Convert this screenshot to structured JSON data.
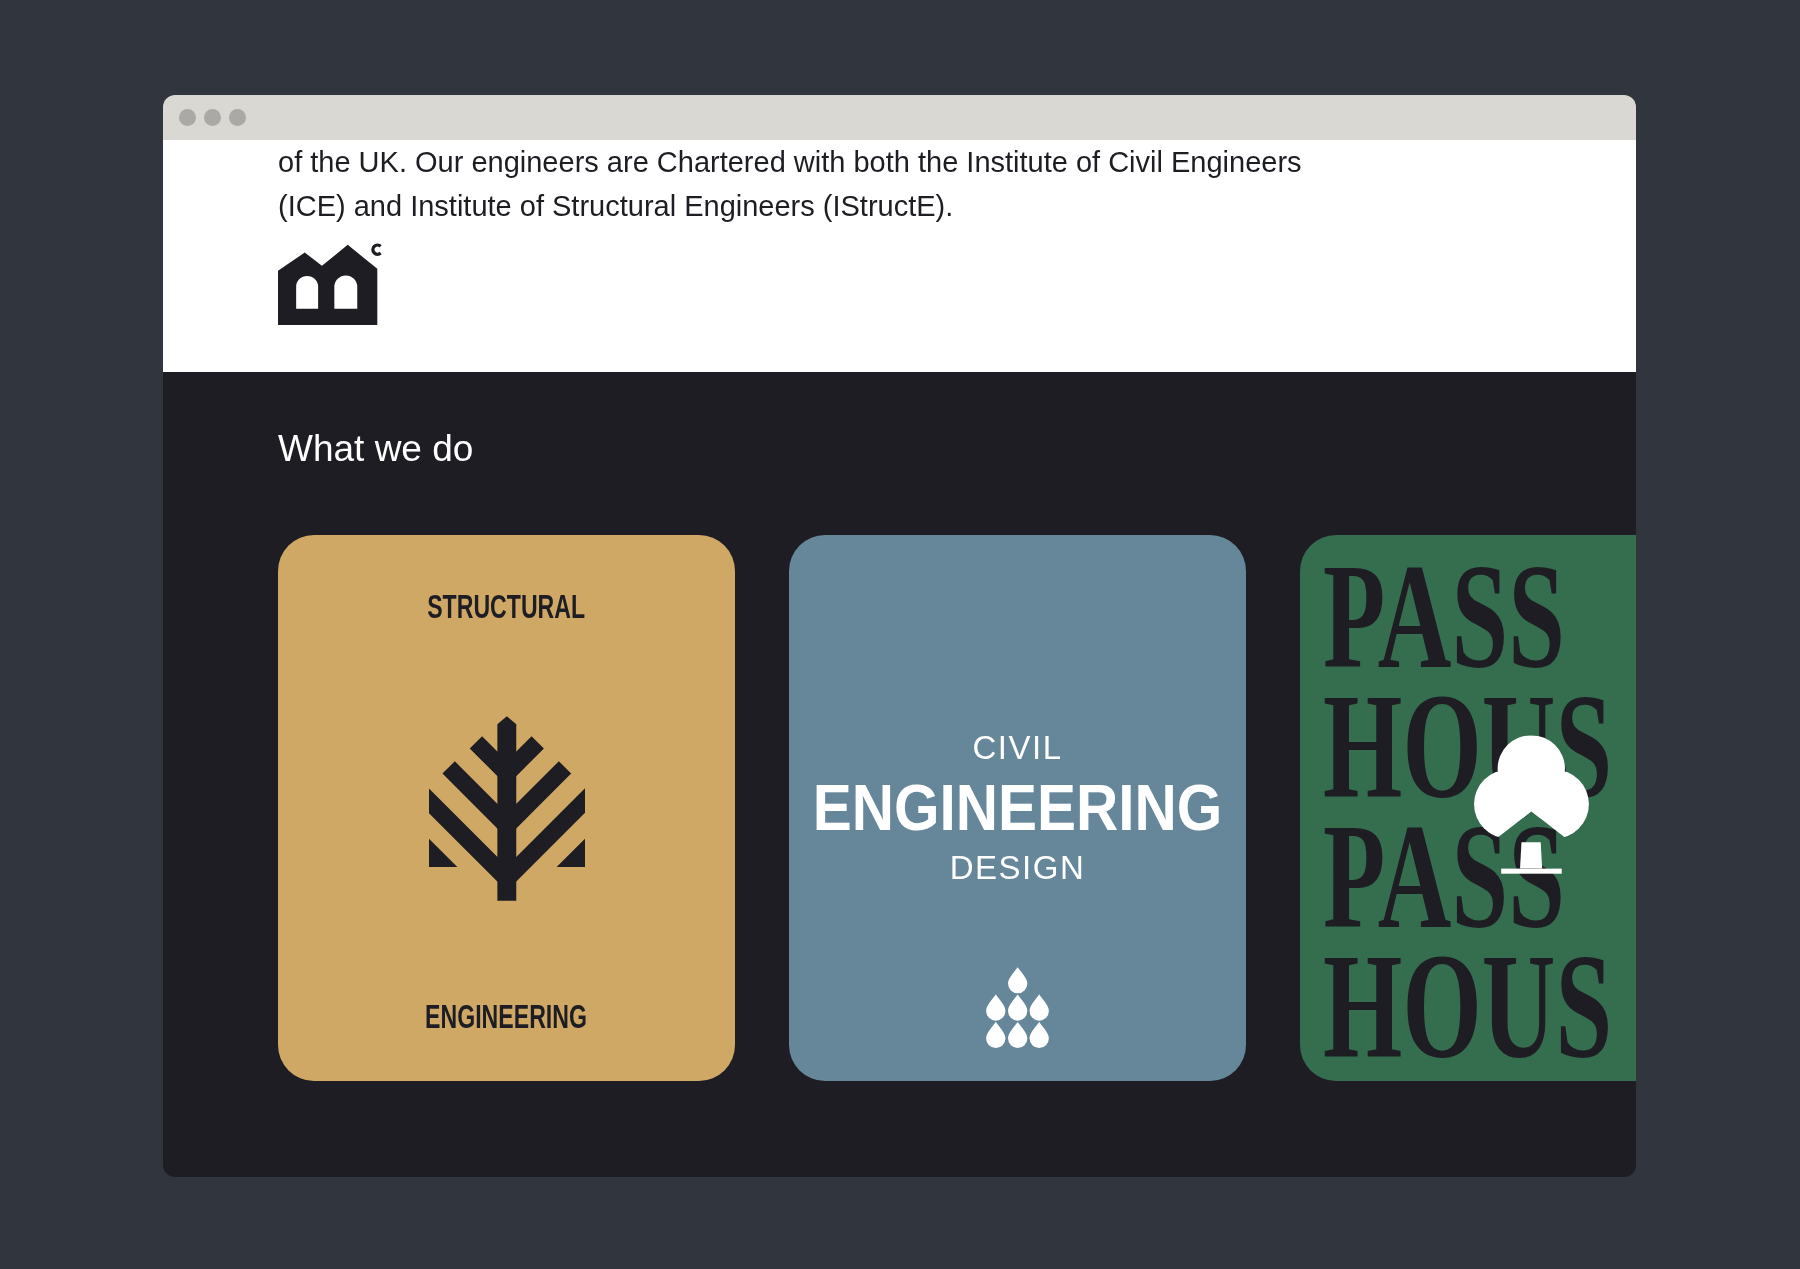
{
  "intro": {
    "text": "of the UK. Our engineers are Chartered with both the Institute of Civil Engineers (ICE) and Institute of Structural Engineers (IStructE)."
  },
  "services": {
    "heading": "What we do",
    "cards": [
      {
        "kind": "structural",
        "color": "#cfa866",
        "top_label": "STRUCTURAL",
        "bottom_label": "ENGINEERING"
      },
      {
        "kind": "civil",
        "color": "#66869a",
        "top_label": "CIVIL",
        "title": "ENGINEERING",
        "bottom_label": "DESIGN"
      },
      {
        "kind": "passive",
        "color": "#356d4f",
        "lines": [
          "PASS",
          "HOUS",
          "PASS",
          "HOUS"
        ]
      }
    ]
  }
}
